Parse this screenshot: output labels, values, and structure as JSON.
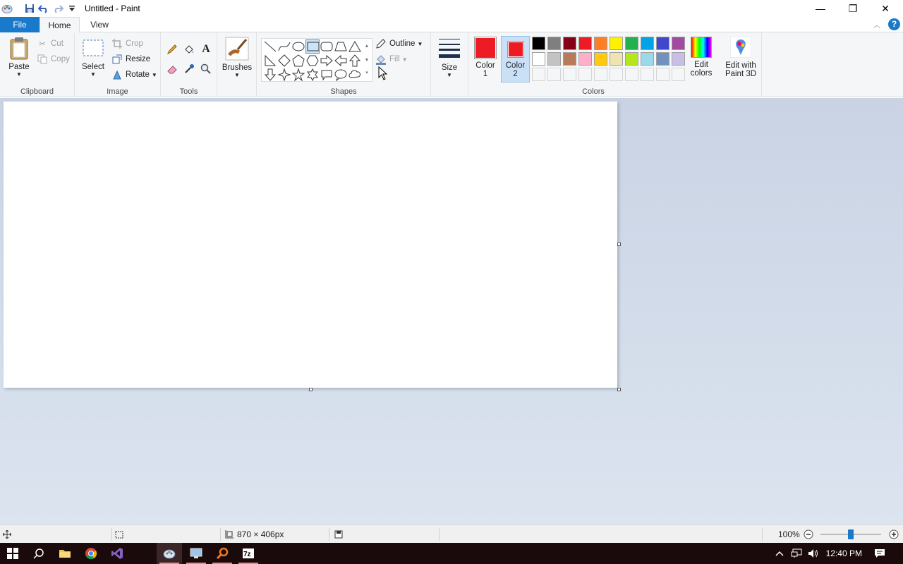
{
  "window": {
    "title": "Untitled - Paint",
    "minimize": "—",
    "restore": "❐",
    "close": "✕"
  },
  "tabs": {
    "file": "File",
    "home": "Home",
    "view": "View",
    "help": "?"
  },
  "clipboard": {
    "paste": "Paste",
    "cut": "Cut",
    "copy": "Copy",
    "label": "Clipboard"
  },
  "image": {
    "select": "Select",
    "crop": "Crop",
    "resize": "Resize",
    "rotate": "Rotate",
    "label": "Image"
  },
  "tools": {
    "label": "Tools"
  },
  "brushes": {
    "label": "Brushes"
  },
  "shapes": {
    "outline": "Outline",
    "fill": "Fill",
    "label": "Shapes"
  },
  "size": {
    "label": "Size"
  },
  "colors": {
    "color1_line1": "Color",
    "color1_line2": "1",
    "color2_line1": "Color",
    "color2_line2": "2",
    "color1_value": "#ed1c24",
    "color2_value": "#ed1c24",
    "edit_colors_line1": "Edit",
    "edit_colors_line2": "colors",
    "paint3d_line1": "Edit with",
    "paint3d_line2": "Paint 3D",
    "label": "Colors",
    "palette_row1": [
      "#000000",
      "#7f7f7f",
      "#880015",
      "#ed1c24",
      "#ff7f27",
      "#fff200",
      "#22b14c",
      "#00a2e8",
      "#3f48cc",
      "#a349a4"
    ],
    "palette_row2": [
      "#ffffff",
      "#c3c3c3",
      "#b97a57",
      "#ffaec9",
      "#ffc90e",
      "#efe4b0",
      "#b5e61d",
      "#99d9ea",
      "#7092be",
      "#c8bfe7"
    ]
  },
  "status": {
    "dimensions": "870 × 406px",
    "zoom": "100%",
    "zoom_level": 0.5
  },
  "taskbar": {
    "time": "12:40 PM"
  }
}
